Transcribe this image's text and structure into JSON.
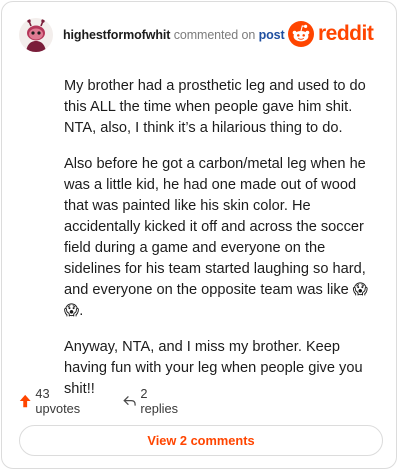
{
  "header": {
    "username": "highestformofwhit",
    "action_text": "commented on",
    "post_link_text": "post",
    "brand_wordmark": "reddit"
  },
  "comment": {
    "paragraphs": [
      "My brother had a prosthetic leg and used to do this ALL the time when people gave him shit. NTA, also, I think it’s a hilarious thing to do.",
      "Also before he got a carbon/metal leg when he was a little kid, he had one made out of wood that was painted like his skin color. He accidentally kicked it off and across the soccer field during a game and everyone on the sidelines for his team started laughing so hard, and everyone on the opposite team was like 😱😱.",
      "Anyway, NTA, and I miss my brother. Keep having fun with your leg when people give you shit!!"
    ]
  },
  "actions": {
    "upvotes_label": "43 upvotes",
    "replies_label": "2 replies",
    "view_comments_label": "View 2 comments"
  },
  "icons": {
    "avatar": "snoo-avatar",
    "brand": "reddit-logo-icon",
    "upvote": "upvote-arrow-icon",
    "reply": "reply-arrow-icon"
  },
  "colors": {
    "brand": "#ff4500",
    "link": "#1f4fa0",
    "muted_text": "#7c7c7c",
    "border": "#dcdcdc"
  }
}
